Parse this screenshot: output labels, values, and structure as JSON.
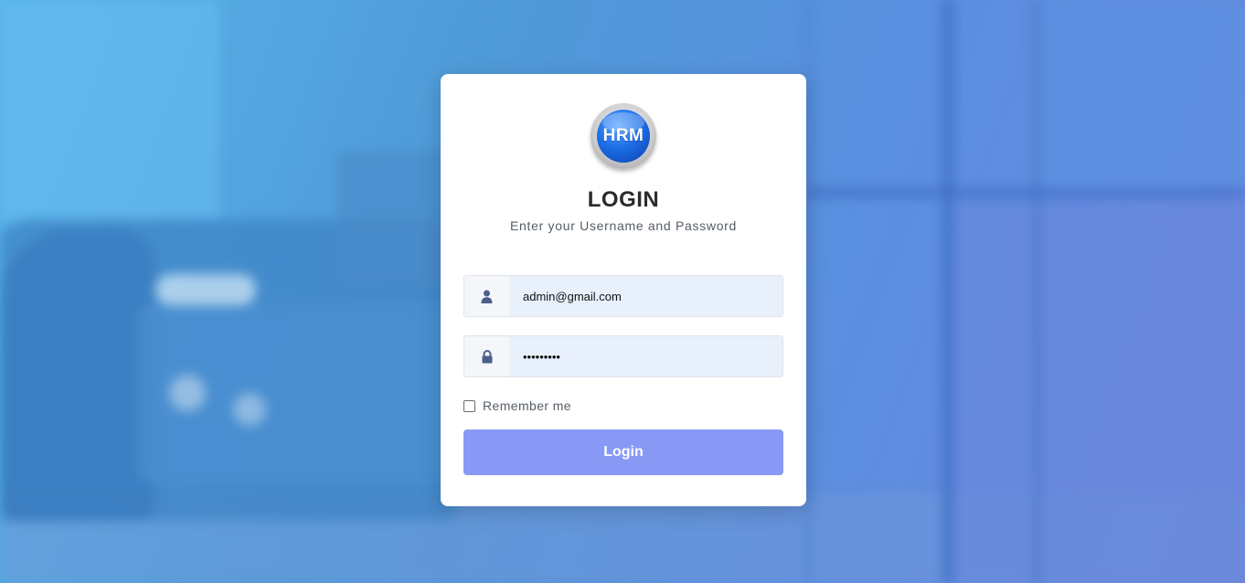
{
  "login_card": {
    "logo_text": "HRM",
    "title": "LOGIN",
    "subtitle": "Enter your Username and Password",
    "username": {
      "value": "admin@gmail.com",
      "icon": "user-icon"
    },
    "password": {
      "value": "•••••••••",
      "icon": "lock-icon"
    },
    "remember_label": "Remember me",
    "remember_checked": false,
    "submit_label": "Login"
  },
  "colors": {
    "button": "#8899f5",
    "input_bg": "#e8f0fc",
    "icon": "#4a5f8c",
    "title": "#2b2b2b"
  }
}
